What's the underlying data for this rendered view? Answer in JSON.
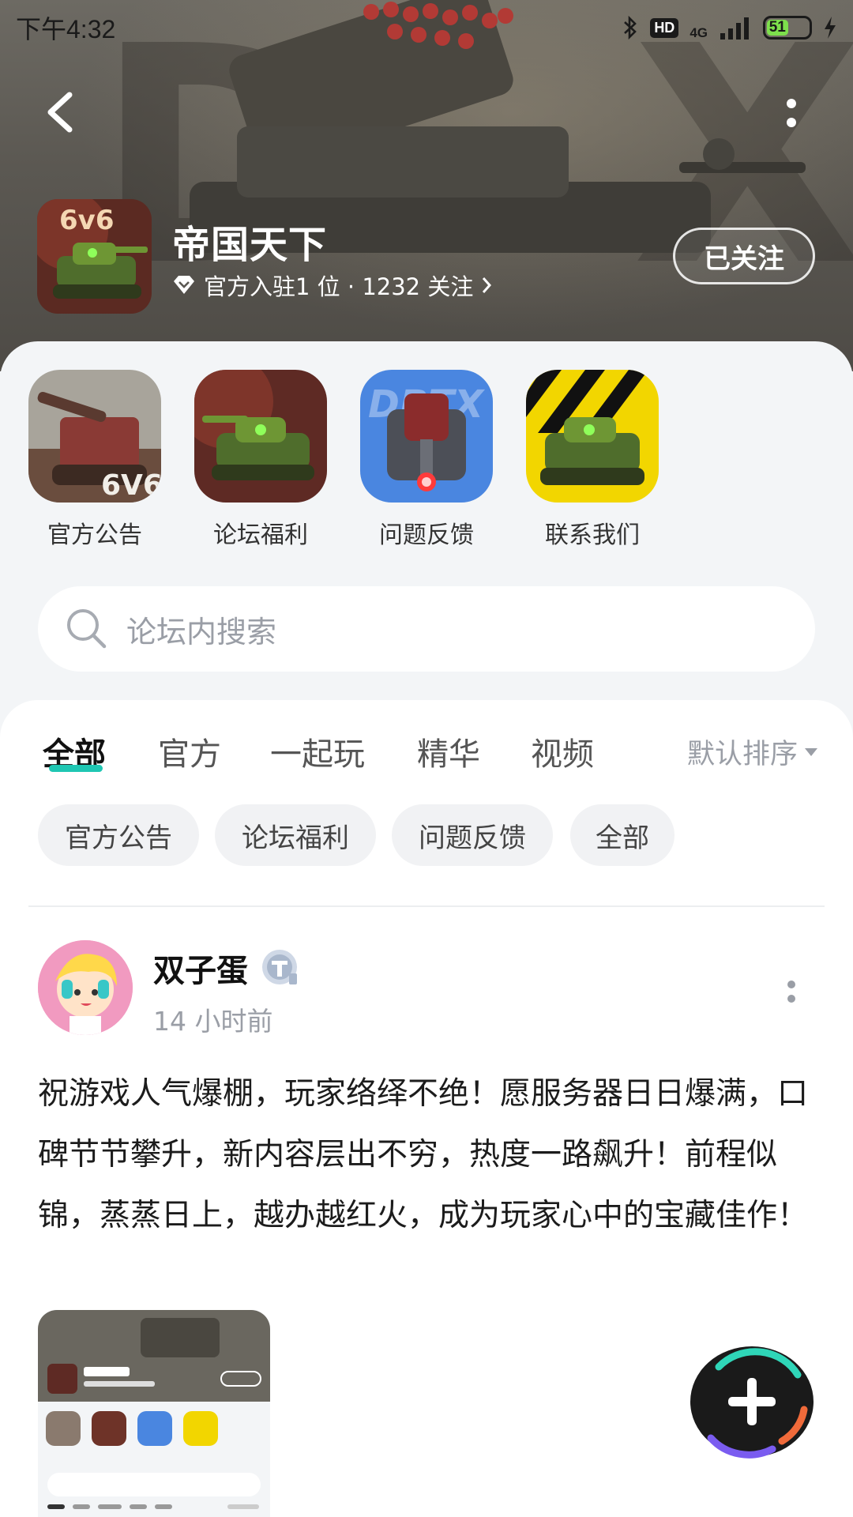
{
  "status_bar": {
    "time": "下午4:32",
    "hd": "HD",
    "network": "4G",
    "battery": "51"
  },
  "header": {
    "game_title": "帝国天下",
    "game_meta": "官方入驻1 位 · 1232 关注",
    "follow_label": "已关注"
  },
  "shortcuts": [
    {
      "label": "官方公告"
    },
    {
      "label": "论坛福利"
    },
    {
      "label": "问题反馈"
    },
    {
      "label": "联系我们"
    }
  ],
  "search": {
    "placeholder": "论坛内搜索"
  },
  "tabs": [
    {
      "label": "全部"
    },
    {
      "label": "官方"
    },
    {
      "label": "一起玩"
    },
    {
      "label": "精华"
    },
    {
      "label": "视频"
    }
  ],
  "sort_label": "默认排序",
  "chips": [
    {
      "label": "官方公告"
    },
    {
      "label": "论坛福利"
    },
    {
      "label": "问题反馈"
    },
    {
      "label": "全部"
    }
  ],
  "post": {
    "author": "双子蛋",
    "time": "14 小时前",
    "body": "祝游戏人气爆棚，玩家络绎不绝！愿服务器日日爆满，口碑节节攀升，新内容层出不穷，热度一路飙升！前程似锦，蒸蒸日上，越办越红火，成为玩家心中的宝藏佳作！"
  },
  "icons": {
    "back": "back-arrow-icon",
    "more": "more-vertical-icon",
    "verified": "verified-diamond-icon",
    "chevron": "chevron-right-icon",
    "search": "search-icon",
    "sort": "caret-down-icon",
    "compose": "plus-icon"
  }
}
